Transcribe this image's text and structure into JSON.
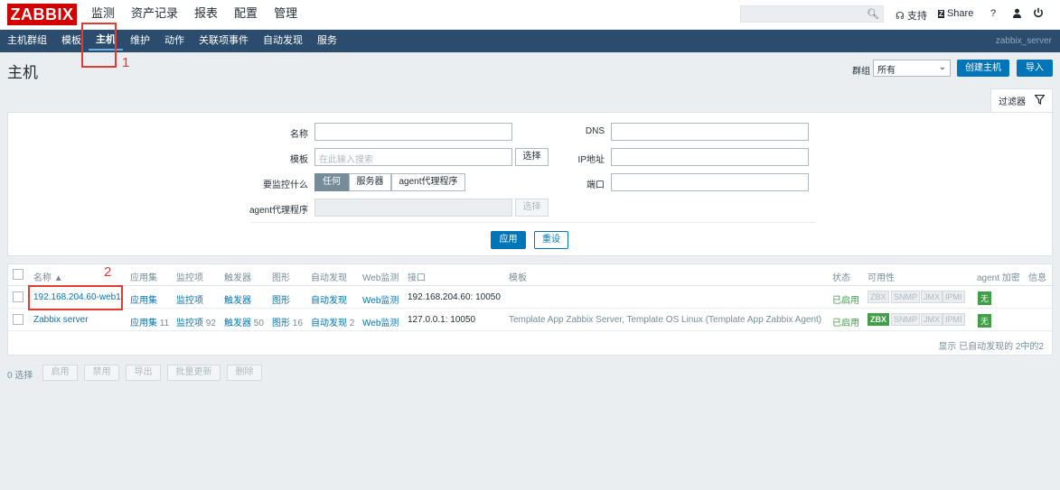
{
  "app": {
    "logo": "ZABBIX"
  },
  "main_menu": [
    "监测",
    "资产记录",
    "报表",
    "配置",
    "管理"
  ],
  "top_right": {
    "support": "支持",
    "share": "Share",
    "help": "?",
    "user_icon": "user-icon",
    "logout_icon": "power-icon"
  },
  "sub_menu": [
    "主机群组",
    "模板",
    "主机",
    "维护",
    "动作",
    "关联项事件",
    "自动发现",
    "服务"
  ],
  "server_name": "zabbix_server",
  "page": {
    "title": "主机",
    "group_label": "群组",
    "group_value": "所有",
    "create_btn": "创建主机",
    "import_btn": "导入"
  },
  "filter": {
    "tab_label": "过滤器",
    "name_label": "名称",
    "template_label": "模板",
    "template_placeholder": "在此输入搜索",
    "select_btn": "选择",
    "monitor_label": "要监控什么",
    "monitor_options": [
      "任何",
      "服务器",
      "agent代理程序"
    ],
    "proxy_label": "agent代理程序",
    "dns_label": "DNS",
    "ip_label": "IP地址",
    "port_label": "端口",
    "apply_btn": "应用",
    "reset_btn": "重设"
  },
  "table": {
    "headers": {
      "name": "名称 ▲",
      "apps": "应用集",
      "items": "监控项",
      "triggers": "触发器",
      "graphs": "图形",
      "discovery": "自动发现",
      "web": "Web监测",
      "interface": "接口",
      "templates": "模板",
      "status": "状态",
      "availability": "可用性",
      "agent_enc": "agent 加密",
      "info": "信息"
    },
    "rows": [
      {
        "name": "192.168.204.60-web1",
        "apps": "应用集",
        "apps_count": "",
        "items": "监控项",
        "items_count": "",
        "triggers": "触发器",
        "triggers_count": "",
        "graphs": "图形",
        "graphs_count": "",
        "discovery": "自动发现",
        "discovery_count": "",
        "web": "Web监测",
        "interface": "192.168.204.60: 10050",
        "templates": "",
        "status": "已启用",
        "avail": [
          "ZBX",
          "SNMP",
          "JMX",
          "IPMI"
        ],
        "zbx_on": false,
        "encryption": "无"
      },
      {
        "name": "Zabbix server",
        "apps": "应用集",
        "apps_count": "11",
        "items": "监控项",
        "items_count": "92",
        "triggers": "触发器",
        "triggers_count": "50",
        "graphs": "图形",
        "graphs_count": "16",
        "discovery": "自动发现",
        "discovery_count": "2",
        "web": "Web监测",
        "interface": "127.0.0.1: 10050",
        "templates": "Template App Zabbix Server, Template OS Linux (Template App Zabbix Agent)",
        "status": "已启用",
        "avail": [
          "ZBX",
          "SNMP",
          "JMX",
          "IPMI"
        ],
        "zbx_on": true,
        "encryption": "无"
      }
    ],
    "footer": "显示 已自动发现的 2中的2"
  },
  "bulk": {
    "selected": "0 选择",
    "buttons": [
      "启用",
      "禁用",
      "导出",
      "批量更新",
      "删除"
    ]
  },
  "annotations": {
    "marker1": "1",
    "marker2": "2"
  },
  "colors": {
    "accent": "#0275b8",
    "nav": "#2b4c6c",
    "logo": "#d40000",
    "enabled": "#429e47",
    "annotation": "#e03c31"
  }
}
